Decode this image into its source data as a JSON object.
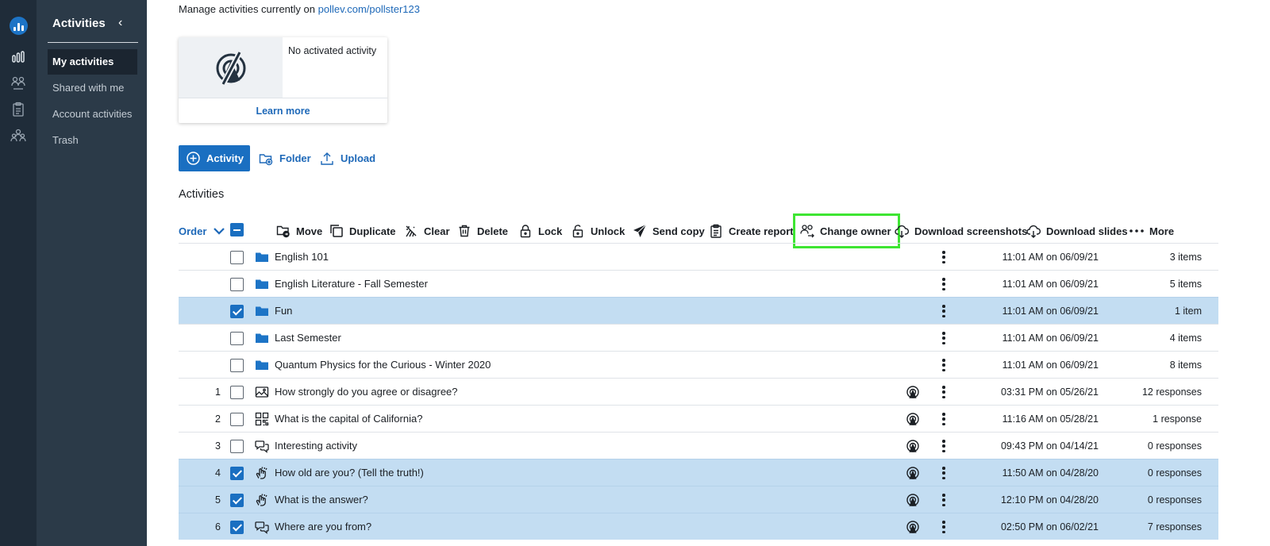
{
  "sidebar": {
    "title": "Activities",
    "items": [
      {
        "label": "My activities",
        "active": true
      },
      {
        "label": "Shared with me",
        "active": false
      },
      {
        "label": "Account activities",
        "active": false
      },
      {
        "label": "Trash",
        "active": false
      }
    ]
  },
  "header": {
    "manage_text": "Manage activities currently on",
    "manage_link": "pollev.com/pollster123"
  },
  "card": {
    "status": "No activated activity",
    "learn_more": "Learn more"
  },
  "actions": {
    "activity": "Activity",
    "folder": "Folder",
    "upload": "Upload"
  },
  "section_title": "Activities",
  "toolbar": {
    "order": "Order",
    "move": "Move",
    "duplicate": "Duplicate",
    "clear": "Clear",
    "delete": "Delete",
    "lock": "Lock",
    "unlock": "Unlock",
    "send_copy": "Send copy",
    "create_report": "Create report",
    "change_owner": "Change owner",
    "download_screenshots": "Download screenshots",
    "download_slides": "Download slides",
    "more": "More"
  },
  "rows": [
    {
      "num": "",
      "type": "folder",
      "name": "English 101",
      "date": "11:01 AM on 06/09/21",
      "count": "3 items",
      "checked": false
    },
    {
      "num": "",
      "type": "folder",
      "name": "English Literature - Fall Semester",
      "date": "11:01 AM on 06/09/21",
      "count": "5 items",
      "checked": false
    },
    {
      "num": "",
      "type": "folder",
      "name": "Fun",
      "date": "11:01 AM on 06/09/21",
      "count": "1 item",
      "checked": true
    },
    {
      "num": "",
      "type": "folder",
      "name": "Last Semester",
      "date": "11:01 AM on 06/09/21",
      "count": "4 items",
      "checked": false
    },
    {
      "num": "",
      "type": "folder",
      "name": "Quantum Physics for the Curious - Winter 2020",
      "date": "11:01 AM on 06/09/21",
      "count": "8 items",
      "checked": false
    },
    {
      "num": "1",
      "type": "image",
      "name": "How strongly do you agree or disagree?",
      "date": "03:31 PM on 05/26/21",
      "count": "12 responses",
      "checked": false
    },
    {
      "num": "2",
      "type": "grid",
      "name": "What is the capital of California?",
      "date": "11:16 AM on 05/28/21",
      "count": "1 response",
      "checked": false
    },
    {
      "num": "3",
      "type": "chat",
      "name": "Interesting activity",
      "date": "09:43 PM on 04/14/21",
      "count": "0 responses",
      "checked": false
    },
    {
      "num": "4",
      "type": "clap",
      "name": "How old are you? (Tell the truth!)",
      "date": "11:50 AM on 04/28/20",
      "count": "0 responses",
      "checked": true
    },
    {
      "num": "5",
      "type": "clap",
      "name": "What is the answer?",
      "date": "12:10 PM on 04/28/20",
      "count": "0 responses",
      "checked": true
    },
    {
      "num": "6",
      "type": "chat",
      "name": "Where are you from?",
      "date": "02:50 PM on 06/02/21",
      "count": "7 responses",
      "checked": true
    }
  ]
}
